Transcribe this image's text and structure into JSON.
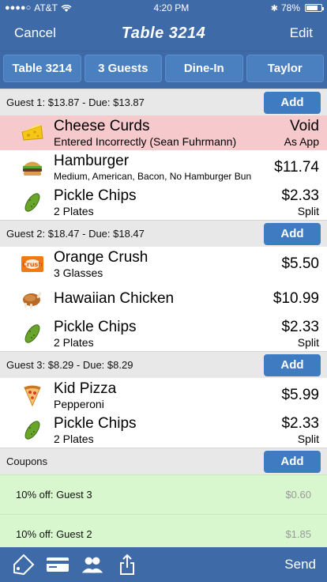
{
  "status": {
    "carrier": "AT&T",
    "time": "4:20 PM",
    "battery": "78%",
    "battery_level": 0.78
  },
  "nav": {
    "cancel": "Cancel",
    "title": "Table 3214",
    "edit": "Edit"
  },
  "header_buttons": [
    "Table 3214",
    "3 Guests",
    "Dine-In",
    "Taylor"
  ],
  "add_label": "Add",
  "guests": [
    {
      "label": "Guest 1: $13.87 - Due: $13.87",
      "items": [
        {
          "icon": "cheese-icon",
          "name": "Cheese Curds",
          "mods": "Entered Incorrectly (Sean Fuhrmann)",
          "price": "Void",
          "price_sub": "As App",
          "void": true
        },
        {
          "icon": "hamburger-icon",
          "name": "Hamburger",
          "mods": "Medium, American, Bacon, No Hamburger Bun",
          "price": "$11.74",
          "price_sub": ""
        },
        {
          "icon": "pickle-icon",
          "name": "Pickle Chips",
          "mods": "2 Plates",
          "price": "$2.33",
          "price_sub": "Split"
        }
      ]
    },
    {
      "label": "Guest 2: $18.47 - Due: $18.47",
      "items": [
        {
          "icon": "orange-crush-icon",
          "name": "Orange Crush",
          "mods": "3 Glasses",
          "price": "$5.50",
          "price_sub": ""
        },
        {
          "icon": "chicken-icon",
          "name": "Hawaiian Chicken",
          "mods": "",
          "price": "$10.99",
          "price_sub": ""
        },
        {
          "icon": "pickle-icon",
          "name": "Pickle Chips",
          "mods": "2 Plates",
          "price": "$2.33",
          "price_sub": "Split"
        }
      ]
    },
    {
      "label": "Guest 3: $8.29 - Due: $8.29",
      "items": [
        {
          "icon": "pizza-icon",
          "name": "Kid Pizza",
          "mods": "Pepperoni",
          "price": "$5.99",
          "price_sub": ""
        },
        {
          "icon": "pickle-icon",
          "name": "Pickle Chips",
          "mods": "2 Plates",
          "price": "$2.33",
          "price_sub": "Split"
        }
      ]
    }
  ],
  "coupons": {
    "label": "Coupons",
    "items": [
      {
        "label": "10% off: Guest 3",
        "amount": "$0.60"
      },
      {
        "label": "10% off: Guest 2",
        "amount": "$1.85"
      }
    ]
  },
  "toolbar": {
    "send": "Send",
    "icons": [
      "discount-tag-icon",
      "credit-card-icon",
      "guests-icon",
      "share-icon"
    ]
  },
  "colors": {
    "nav": "#3f6aa8",
    "button": "#4a7fc0",
    "void_row": "#f6c9cd",
    "coupon_row": "#d9f7cf"
  }
}
